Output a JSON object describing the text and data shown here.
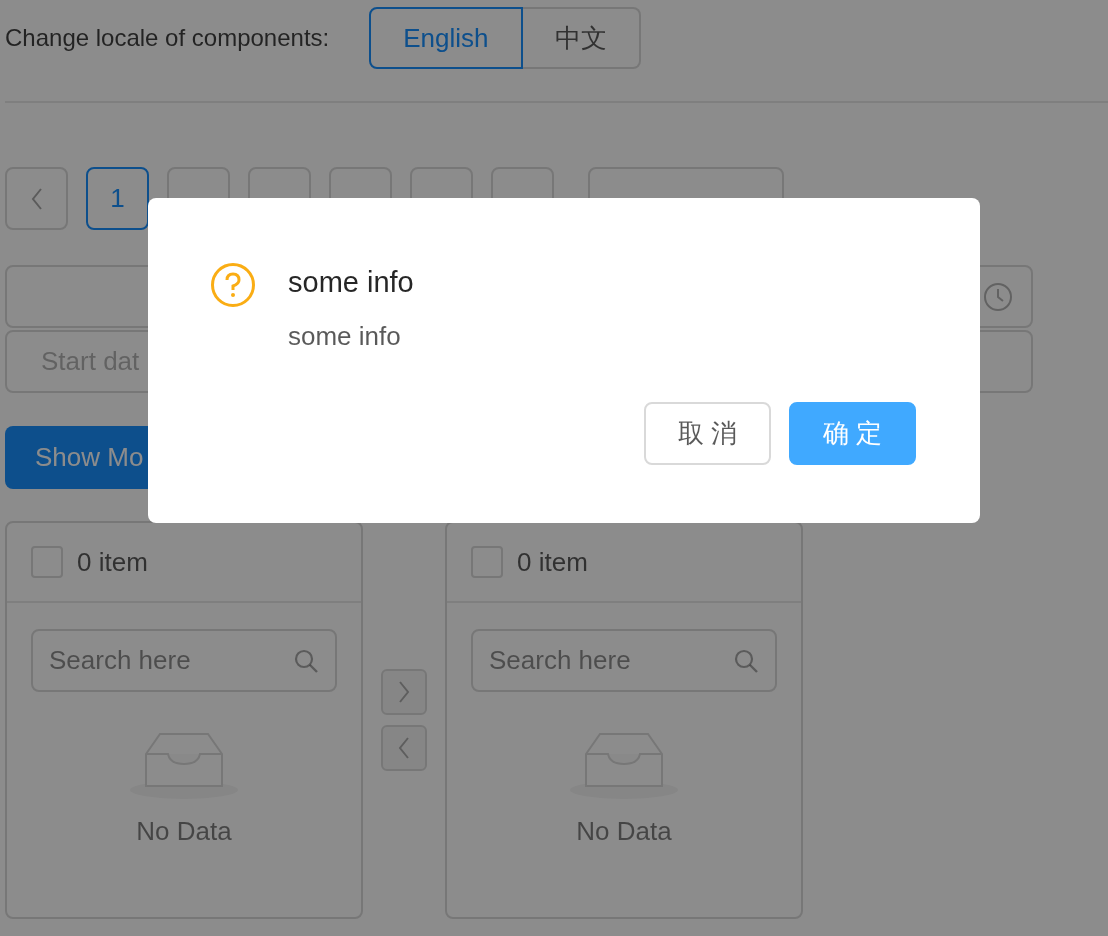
{
  "locale": {
    "label": "Change locale of components:",
    "options": [
      {
        "label": "English",
        "selected": true
      },
      {
        "label": "中文",
        "selected": false
      }
    ]
  },
  "pagination": {
    "items": [
      {
        "kind": "prev"
      },
      {
        "kind": "page",
        "label": "1",
        "selected": true
      },
      {
        "kind": "page",
        "selected": false
      },
      {
        "kind": "page",
        "selected": false
      },
      {
        "kind": "page",
        "selected": false
      },
      {
        "kind": "page",
        "selected": false
      },
      {
        "kind": "next"
      }
    ]
  },
  "range_picker": {
    "start_placeholder": "Start dat"
  },
  "show_modal_button": "Show Mo",
  "transfer": {
    "lists": [
      {
        "checked": false,
        "count": "0 item",
        "search_placeholder": "Search here",
        "empty_text": "No Data"
      },
      {
        "checked": false,
        "count": "0 item",
        "search_placeholder": "Search here",
        "empty_text": "No Data"
      }
    ]
  },
  "modal": {
    "title": "some info",
    "content": "some info",
    "buttons": [
      {
        "kind": "default",
        "label": "取 消"
      },
      {
        "kind": "primary",
        "label": "确 定"
      }
    ]
  }
}
